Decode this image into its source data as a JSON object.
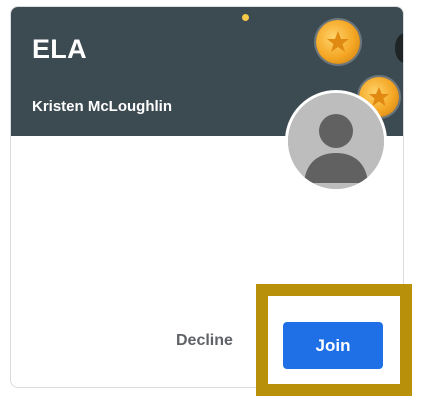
{
  "card": {
    "class_name": "ELA",
    "teacher_name": "Kristen McLoughlin"
  },
  "actions": {
    "decline_label": "Decline",
    "join_label": "Join"
  },
  "icons": {
    "avatar": "person-avatar-icon",
    "coin": "star-coin-icon"
  },
  "colors": {
    "header_bg": "#3c4a52",
    "join_bg": "#1f6fe6",
    "highlight_border": "#b8900a"
  }
}
